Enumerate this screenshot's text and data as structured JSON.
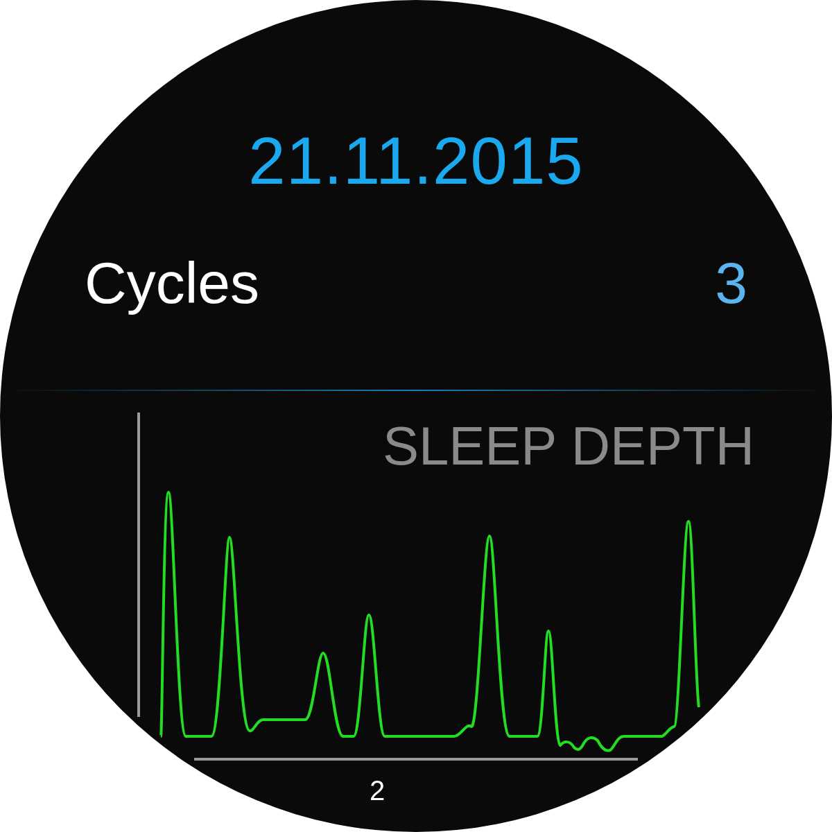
{
  "date": "21.11.2015",
  "stat": {
    "label": "Cycles",
    "value": "3"
  },
  "chart": {
    "title": "SLEEP DEPTH",
    "x_tick_labels": [
      "2"
    ]
  }
}
